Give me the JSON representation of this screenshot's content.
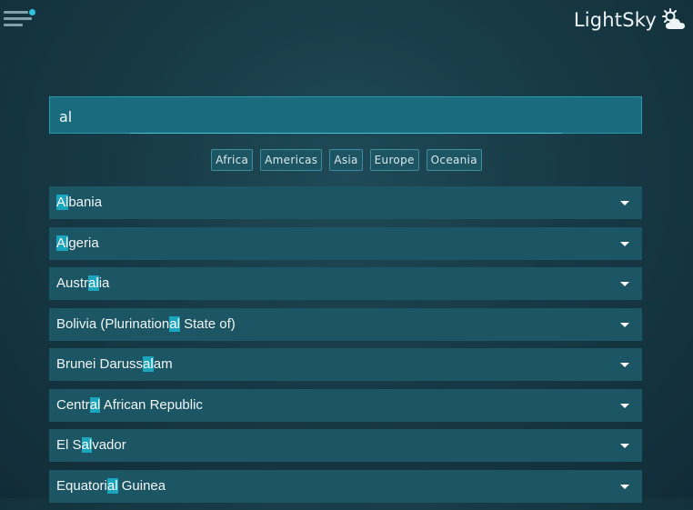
{
  "header": {
    "app_name": "LightSky",
    "menu_icon": "hamburger-menu-icon",
    "logo_icon": "sun-cloud-icon"
  },
  "search": {
    "value": "al",
    "placeholder": ""
  },
  "filters": [
    "Africa",
    "Americas",
    "Asia",
    "Europe",
    "Oceania"
  ],
  "countries": [
    {
      "pre": "",
      "match": "Al",
      "post": "bania"
    },
    {
      "pre": "",
      "match": "Al",
      "post": "geria"
    },
    {
      "pre": "Austr",
      "match": "al",
      "post": "ia"
    },
    {
      "pre": "Bolivia (Plurination",
      "match": "al",
      "post": " State of)"
    },
    {
      "pre": "Brunei Daruss",
      "match": "al",
      "post": "am"
    },
    {
      "pre": "Centr",
      "match": "al",
      "post": " African Republic"
    },
    {
      "pre": "El S",
      "match": "al",
      "post": "vador"
    },
    {
      "pre": "Equatori",
      "match": "al",
      "post": " Guinea"
    }
  ],
  "colors": {
    "accent": "#1aa5bf",
    "row_bg": "#1c5564",
    "search_bg": "#1a6b7e"
  }
}
